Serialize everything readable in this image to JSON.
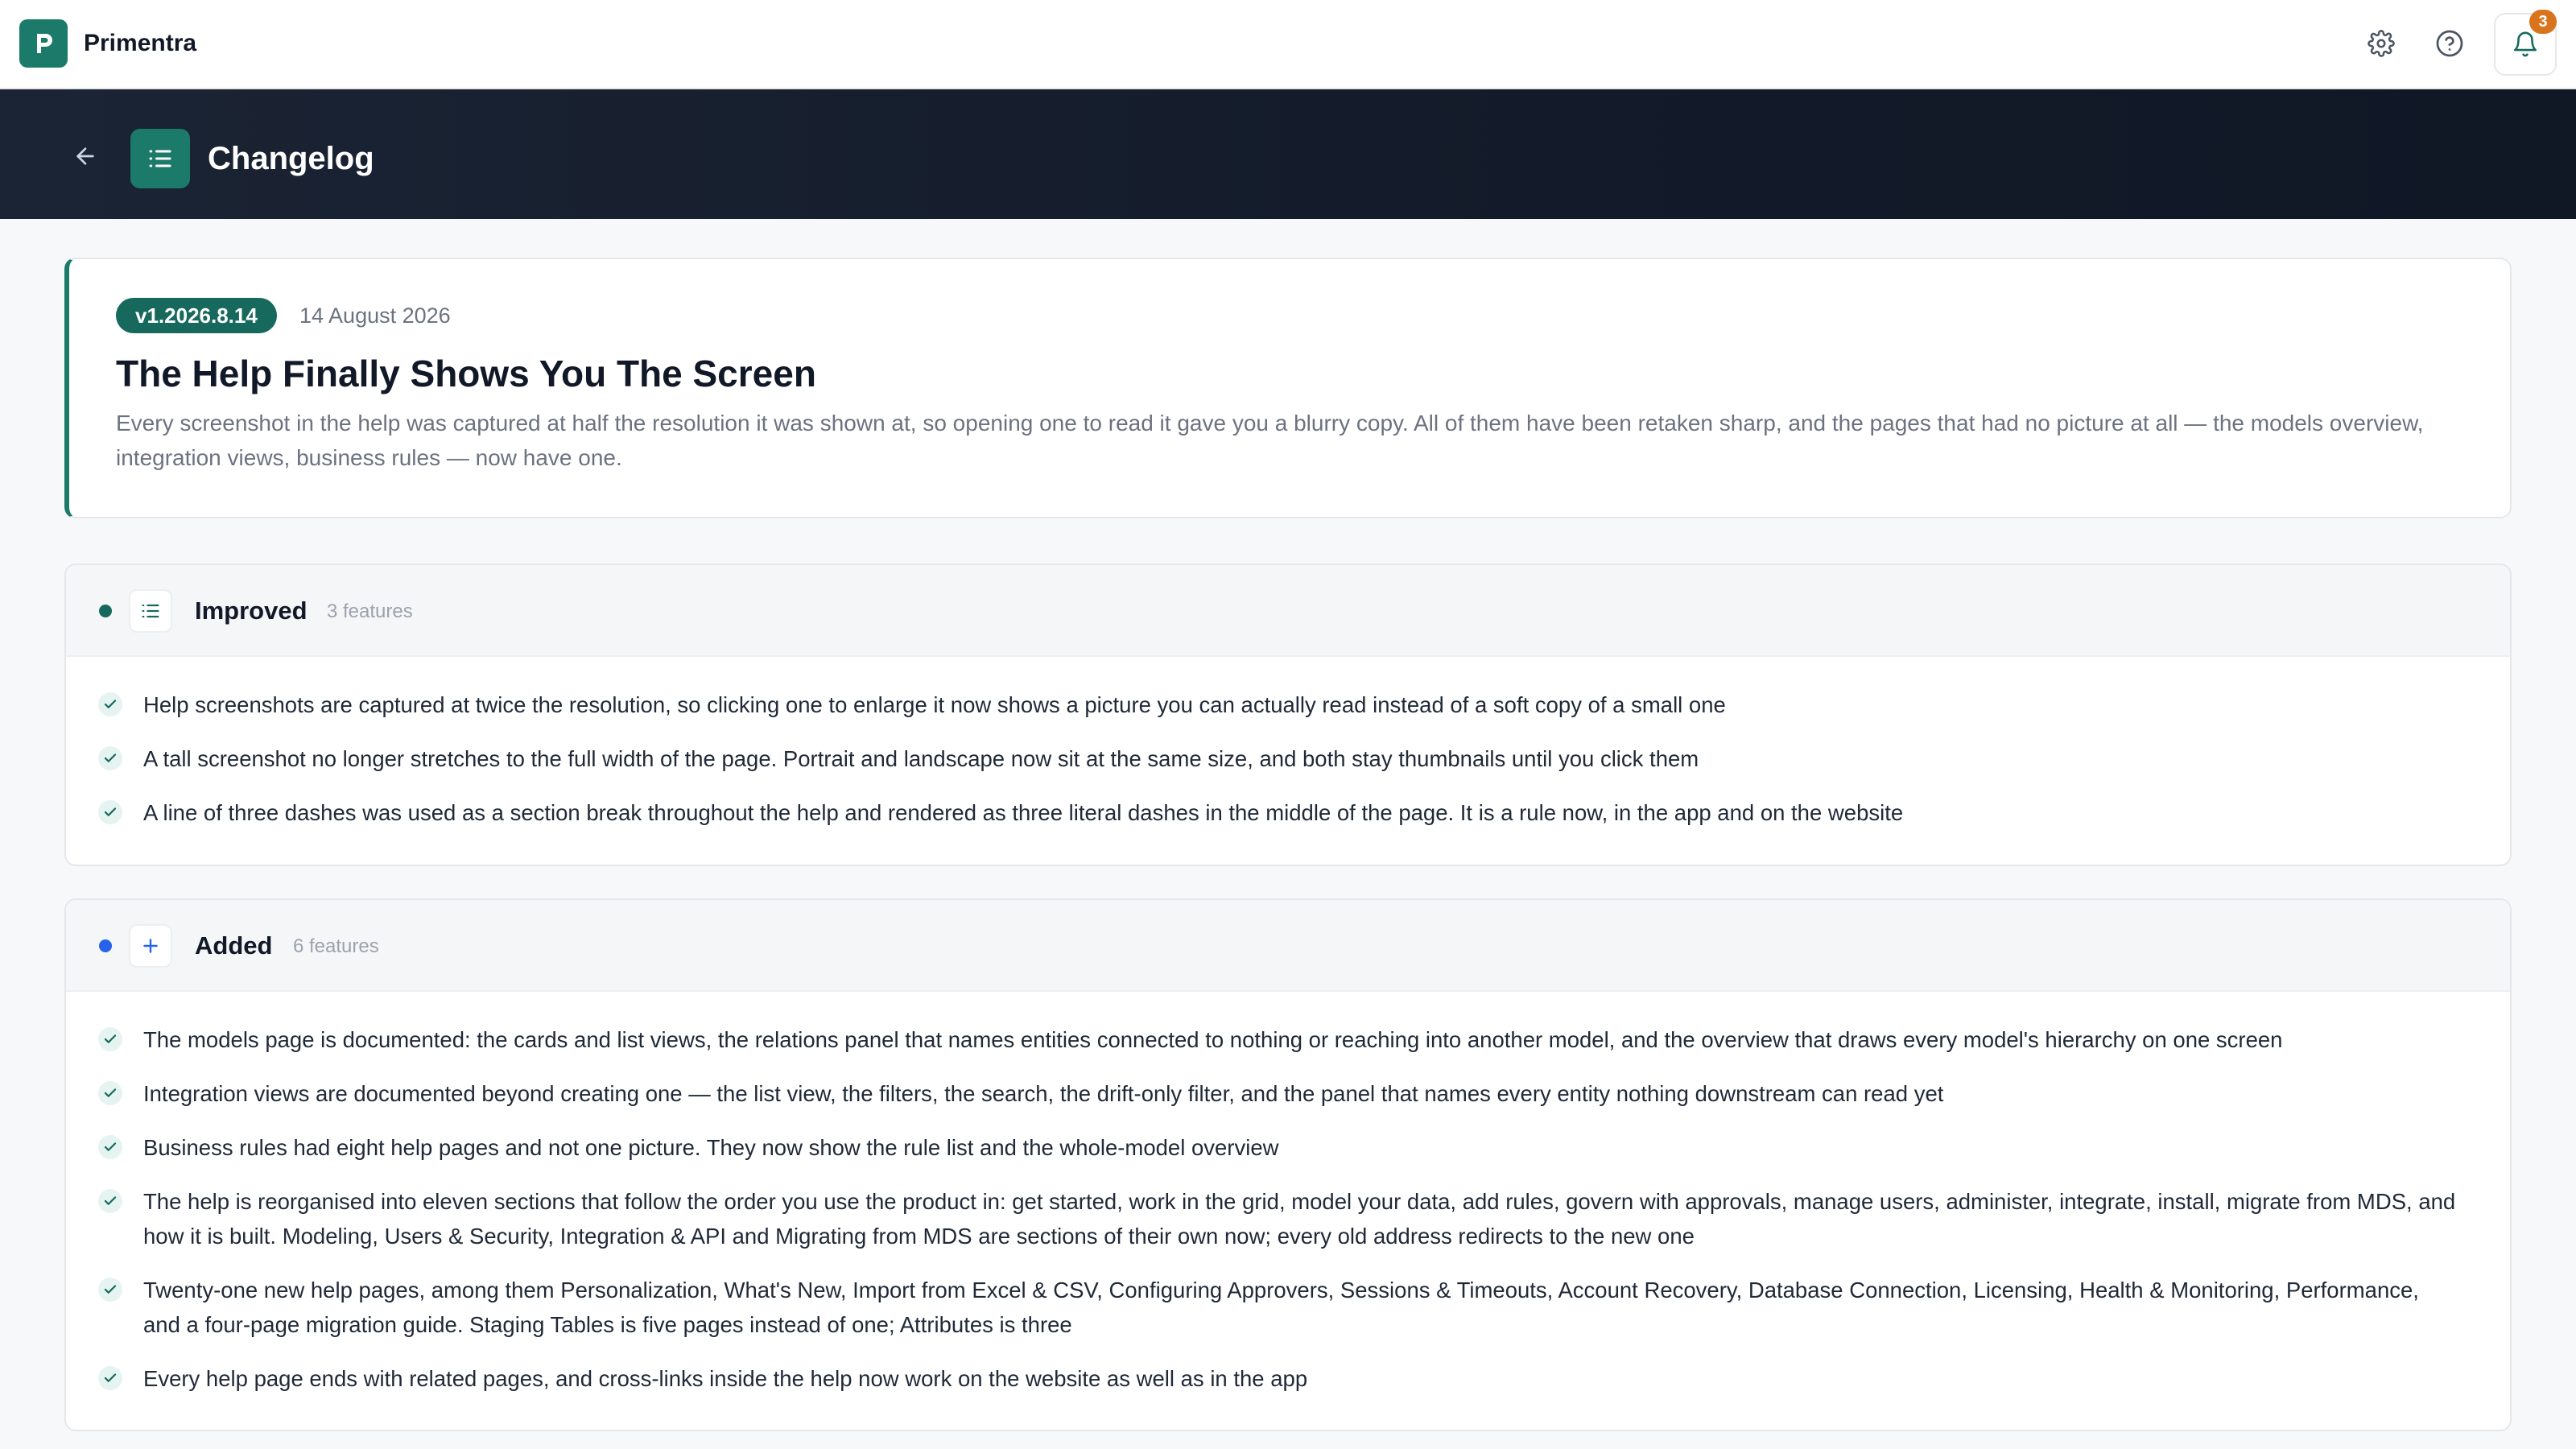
{
  "app": {
    "name": "Primentra",
    "logo_letter": "P",
    "brand_color": "#1c7a6a"
  },
  "topbar": {
    "icons": [
      "gear-icon",
      "help-circle-icon",
      "bell-icon"
    ],
    "notification_count": "3",
    "badge_color": "#d9731c"
  },
  "header": {
    "title": "Changelog",
    "back_icon": "arrow-left-icon",
    "page_icon": "list-icon"
  },
  "release": {
    "version": "v1.2026.8.14",
    "date": "14 August 2026",
    "title": "The Help Finally Shows You The Screen",
    "description": "Every screenshot in the help was captured at half the resolution it was shown at, so opening one to read it gave you a blurry copy. All of them have been retaken sharp, and the pages that had no picture at all — the models overview, integration views, business rules — now have one."
  },
  "sections": [
    {
      "title": "Improved",
      "count": "3 features",
      "dot_color": "#16695c",
      "icon": "list-icon",
      "items": [
        "Help screenshots are captured at twice the resolution, so clicking one to enlarge it now shows a picture you can actually read instead of a soft copy of a small one",
        "A tall screenshot no longer stretches to the full width of the page. Portrait and landscape now sit at the same size, and both stay thumbnails until you click them",
        "A line of three dashes was used as a section break throughout the help and rendered as three literal dashes in the middle of the page. It is a rule now, in the app and on the website"
      ]
    },
    {
      "title": "Added",
      "count": "6 features",
      "dot_color": "#2563eb",
      "icon": "plus-icon",
      "items": [
        "The models page is documented: the cards and list views, the relations panel that names entities connected to nothing or reaching into another model, and the overview that draws every model's hierarchy on one screen",
        "Integration views are documented beyond creating one — the list view, the filters, the search, the drift-only filter, and the panel that names every entity nothing downstream can read yet",
        "Business rules had eight help pages and not one picture. They now show the rule list and the whole-model overview",
        "The help is reorganised into eleven sections that follow the order you use the product in: get started, work in the grid, model your data, add rules, govern with approvals, manage users, administer, integrate, install, migrate from MDS, and how it is built. Modeling, Users & Security, Integration & API and Migrating from MDS are sections of their own now; every old address redirects to the new one",
        "Twenty-one new help pages, among them Personalization, What's New, Import from Excel & CSV, Configuring Approvers, Sessions & Timeouts, Account Recovery, Database Connection, Licensing, Health & Monitoring, Performance, and a four-page migration guide. Staging Tables is five pages instead of one; Attributes is three",
        "Every help page ends with related pages, and cross-links inside the help now work on the website as well as in the app"
      ]
    }
  ]
}
